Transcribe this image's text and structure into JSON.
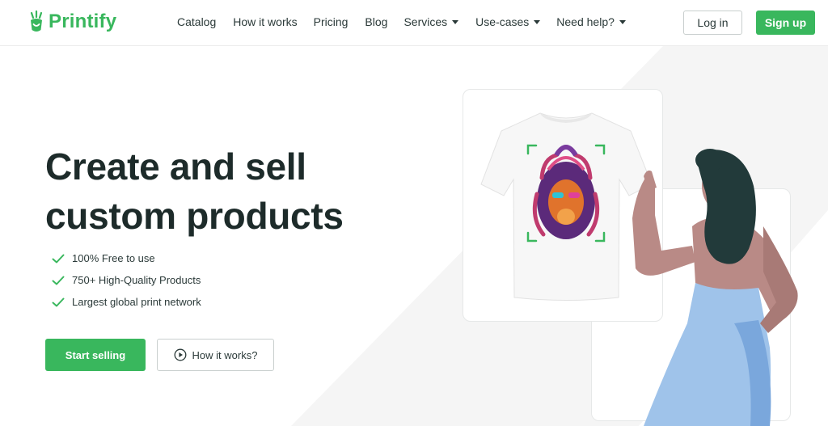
{
  "header": {
    "brand": "Printify",
    "nav": [
      {
        "label": "Catalog",
        "dropdown": false
      },
      {
        "label": "How it works",
        "dropdown": false
      },
      {
        "label": "Pricing",
        "dropdown": false
      },
      {
        "label": "Blog",
        "dropdown": false
      },
      {
        "label": "Services",
        "dropdown": true
      },
      {
        "label": "Use-cases",
        "dropdown": true
      },
      {
        "label": "Need help?",
        "dropdown": true
      }
    ],
    "login_label": "Log in",
    "signup_label": "Sign up"
  },
  "hero": {
    "headline_line1": "Create and sell",
    "headline_line2": "custom products",
    "features": [
      "100% Free to use",
      "750+ High-Quality Products",
      "Largest global print network"
    ],
    "start_label": "Start selling",
    "how_label": "How it works?"
  },
  "colors": {
    "brand_green": "#39b75d",
    "headline": "#1d2b2a",
    "background_shape": "#f5f5f5"
  },
  "icons": [
    "printify-logo-icon",
    "check-icon",
    "play-icon",
    "chevron-down-icon"
  ]
}
